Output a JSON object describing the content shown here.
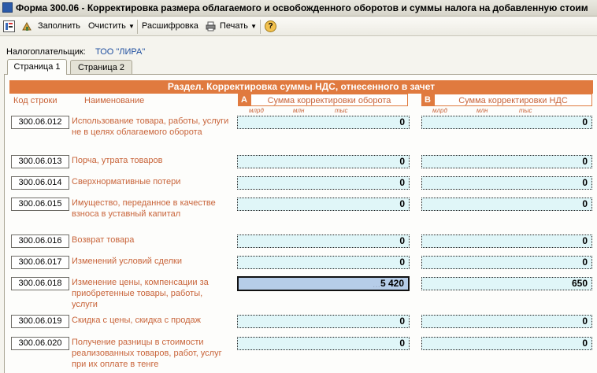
{
  "window": {
    "title": "Форма 300.06 - Корректировка размера облагаемого и освобожденного оборотов и суммы налога на добавленную стоим"
  },
  "toolbar": {
    "fill": "Заполнить",
    "clear": "Очистить",
    "decode": "Расшифровка",
    "print": "Печать",
    "help": "?"
  },
  "taxpayer": {
    "label": "Налогоплательщик:",
    "value": "ТОО \"ЛИРА\""
  },
  "tabs": [
    {
      "label": "Страница 1",
      "active": true
    },
    {
      "label": "Страница 2",
      "active": false
    }
  ],
  "section": {
    "title": "Раздел. Корректировка суммы НДС, отнесенного в зачет",
    "col_code": "Код строки",
    "col_name": "Наименование",
    "col_a_letter": "А",
    "col_a": "Сумма корректировки оборота",
    "col_b_letter": "В",
    "col_b": "Сумма корректировки НДС",
    "units": [
      "млрд",
      "млн",
      "тыс"
    ]
  },
  "rows": [
    {
      "code": "300.06.012",
      "name": "Использование товара, работы, услуги не в целях облагаемого оборота",
      "a": "0",
      "b": "0"
    },
    {
      "code": "300.06.013",
      "name": "Порча, утрата товаров",
      "a": "0",
      "b": "0"
    },
    {
      "code": "300.06.014",
      "name": "Сверхнормативные потери",
      "a": "0",
      "b": "0"
    },
    {
      "code": "300.06.015",
      "name": "Имущество, переданное в качестве взноса в уставный капитал",
      "a": "0",
      "b": "0"
    },
    {
      "code": "300.06.016",
      "name": "Возврат товара",
      "a": "0",
      "b": "0"
    },
    {
      "code": "300.06.017",
      "name": "Изменений условий сделки",
      "a": "0",
      "b": "0"
    },
    {
      "code": "300.06.018",
      "name": "Изменение цены, компенсации за приобретенные товары, работы, услуги",
      "a": "5 420",
      "b": "650",
      "a_hint": "...",
      "selected": true
    },
    {
      "code": "300.06.019",
      "name": "Скидка с цены, скидка с продаж",
      "a": "0",
      "b": "0"
    },
    {
      "code": "300.06.020",
      "name": "Получение разницы в стоимости реализованных товаров, работ, услуг при их оплате в тенге",
      "a": "0",
      "b": "0"
    }
  ],
  "colors": {
    "accent": "#e07a3f",
    "field_bg": "#e0f6f8",
    "label_text": "#c8643a",
    "selected_field": "#b6cde8"
  }
}
